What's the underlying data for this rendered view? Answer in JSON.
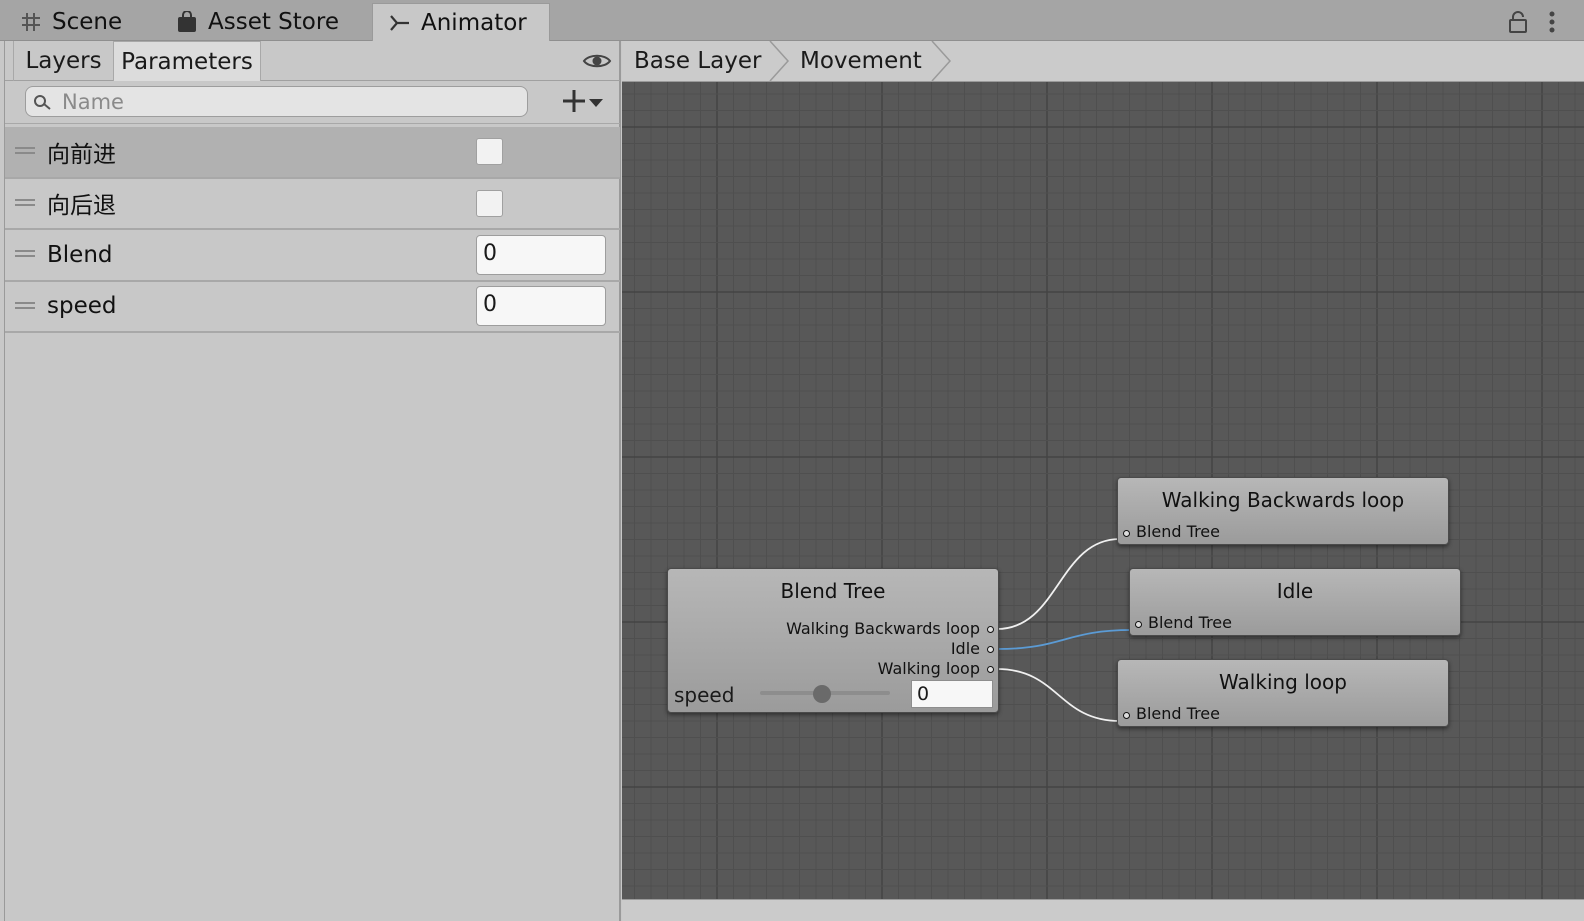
{
  "window_tabs": [
    {
      "label": "Scene",
      "icon": "grid-icon"
    },
    {
      "label": "Asset Store",
      "icon": "shopping-bag-icon"
    },
    {
      "label": "Animator",
      "icon": "animator-icon",
      "active": true
    }
  ],
  "left_panel": {
    "tabs": {
      "layers": "Layers",
      "parameters": "Parameters"
    },
    "search_placeholder": "Name",
    "parameters": [
      {
        "name": "向前进",
        "type": "bool",
        "value": false,
        "selected": true
      },
      {
        "name": "向后退",
        "type": "bool",
        "value": false
      },
      {
        "name": "Blend",
        "type": "float",
        "value": "0"
      },
      {
        "name": "speed",
        "type": "float",
        "value": "0"
      }
    ]
  },
  "breadcrumb": [
    "Base Layer",
    "Movement"
  ],
  "graph": {
    "blend_tree": {
      "title": "Blend Tree",
      "outputs": [
        "Walking Backwards loop",
        "Idle",
        "Walking loop"
      ],
      "param_label": "speed",
      "param_value": "0"
    },
    "children": [
      {
        "title": "Walking Backwards loop",
        "input_label": "Blend Tree"
      },
      {
        "title": "Idle",
        "input_label": "Blend Tree"
      },
      {
        "title": "Walking loop",
        "input_label": "Blend Tree"
      }
    ],
    "colors": {
      "background": "#585858",
      "active_connection": "#5b9bd5",
      "connection": "#f0f0f0"
    }
  }
}
